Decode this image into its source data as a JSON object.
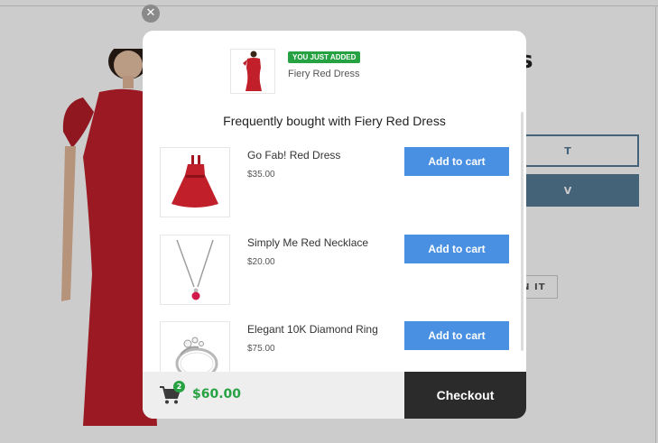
{
  "background": {
    "product_title": "ess",
    "outline_button_label": "T",
    "solid_button_label": "V",
    "pin_button_label": "IN IT"
  },
  "modal": {
    "close_icon": "close-icon",
    "just_added": {
      "badge": "YOU JUST ADDED",
      "name": "Fiery Red Dress"
    },
    "fbt_title": "Frequently bought with Fiery Red Dress",
    "items": [
      {
        "name": "Go Fab! Red Dress",
        "price": "$35.00",
        "button": "Add to cart",
        "icon": "red-dress-image"
      },
      {
        "name": "Simply Me Red Necklace",
        "price": "$20.00",
        "button": "Add to cart",
        "icon": "necklace-image"
      },
      {
        "name": "Elegant 10K Diamond Ring",
        "price": "$75.00",
        "button": "Add to cart",
        "icon": "diamond-ring-image"
      }
    ],
    "footer": {
      "cart_count": "2",
      "total": "$60.00",
      "checkout": "Checkout"
    }
  },
  "colors": {
    "accent_green": "#27a243",
    "add_button_blue": "#4a90e2",
    "checkout_dark": "#2b2b2b",
    "background_button_blue": "#557b97"
  }
}
